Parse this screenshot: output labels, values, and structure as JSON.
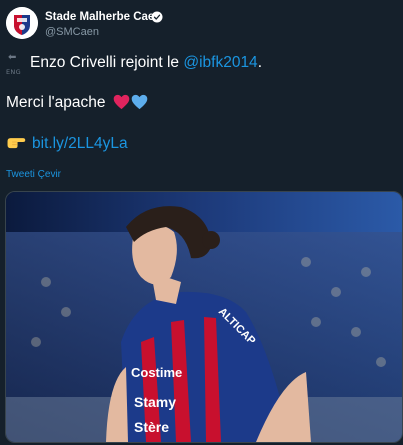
{
  "author": {
    "name": "Stade Malherbe Caen",
    "handle": "@SMCaen",
    "verified": true,
    "avatar_icon": "smcaen-crest-icon"
  },
  "tweet": {
    "line1_text": "Enzo Crivelli rejoint le ",
    "line1_mention": "@ibfk2014",
    "line1_end": ".",
    "line1_flag_label": "ENG",
    "line2_text": "Merci l'apache",
    "line3_link": "bit.ly/2LL4yLa",
    "emoji": [
      "red-heart-icon",
      "blue-heart-icon",
      "pointing-hand-icon"
    ]
  },
  "translate_label": "Tweeti Çevir",
  "media": {
    "alt": "player-photo",
    "jersey_texts": [
      "ALTICAP",
      "Costime",
      "Stamy",
      "Stère"
    ]
  },
  "colors": {
    "background": "#15202b",
    "link": "#1b95e0",
    "secondary_text": "#8899a6"
  }
}
